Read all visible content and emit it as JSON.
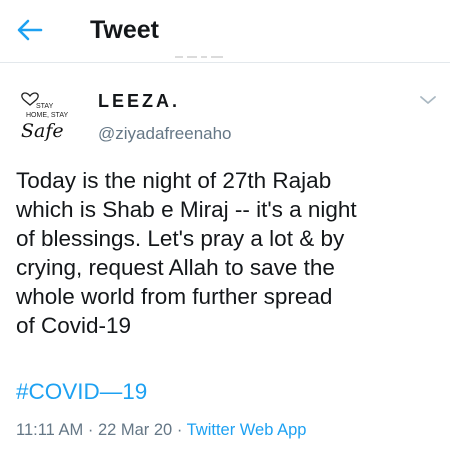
{
  "header": {
    "title": "Tweet",
    "back_icon": "arrow-left-icon"
  },
  "author": {
    "avatar_text_lines": [
      "STAY",
      "HOME, STAY",
      "Safe"
    ],
    "display_name": "LEEZA.",
    "handle": "@ziyadafreenaho"
  },
  "tweet": {
    "text": "Today is the night of 27th Rajab\nwhich is Shab e Miraj -- it's a night\nof blessings. Let's pray a lot & by\ncrying, request Allah to save the\nwhole world from further spread\nof Covid-19",
    "hashtag": "#COVID—19",
    "time": "11:11 AM",
    "sep1": " · ",
    "date": "22 Mar 20",
    "sep2": " · ",
    "source": "Twitter Web App"
  },
  "colors": {
    "accent": "#1da1f2",
    "text": "#14171a",
    "muted": "#657786"
  }
}
